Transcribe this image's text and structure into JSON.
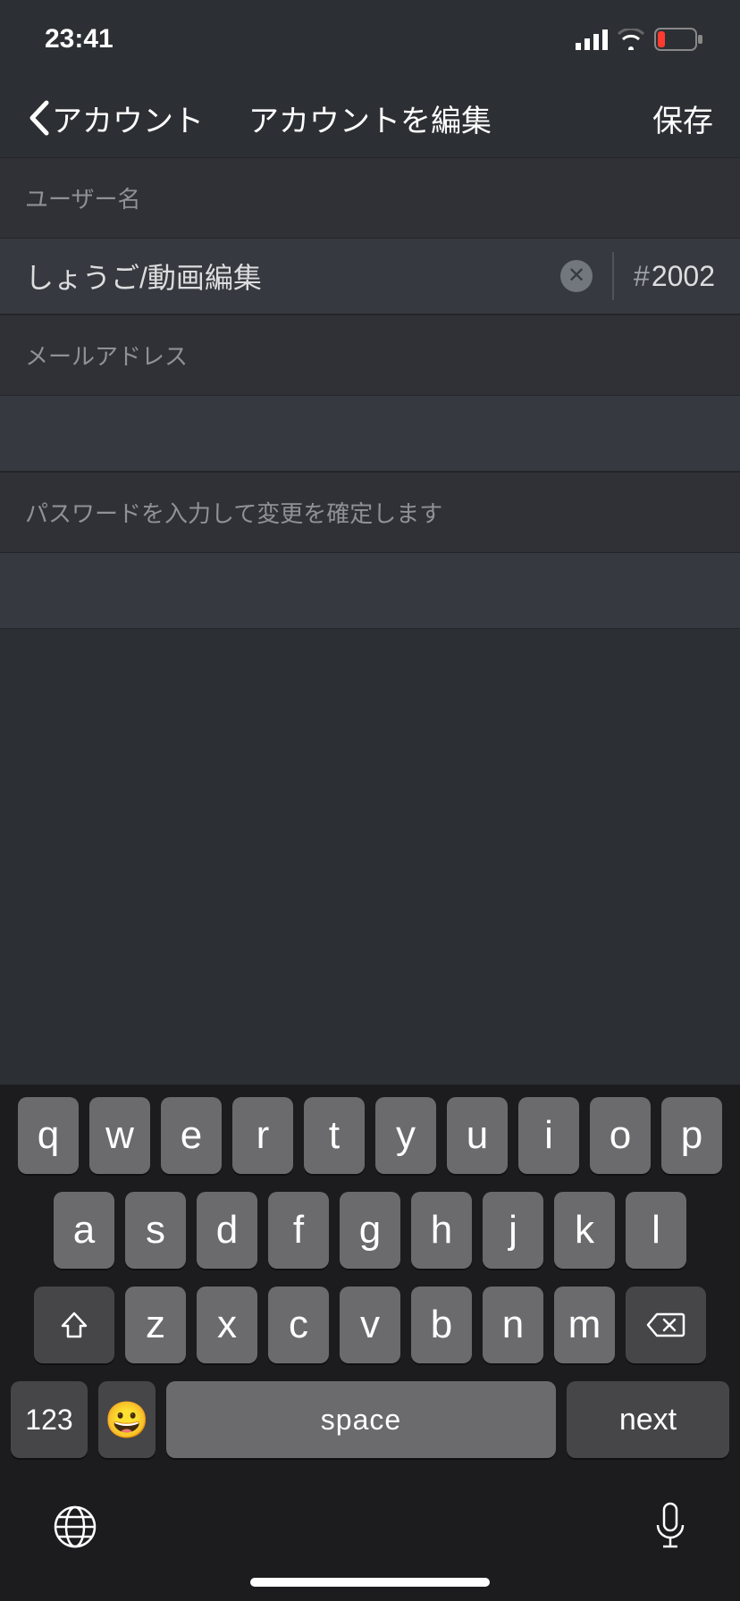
{
  "status": {
    "time": "23:41"
  },
  "nav": {
    "back": "アカウント",
    "title": "アカウントを編集",
    "save": "保存"
  },
  "form": {
    "username_label": "ユーザー名",
    "username_value": "しょうご/動画編集",
    "discrim_hash": "#",
    "discrim_value": "2002",
    "email_label": "メールアドレス",
    "email_value": "",
    "password_label": "パスワードを入力して変更を確定します",
    "password_value": ""
  },
  "keyboard": {
    "row1": [
      "q",
      "w",
      "e",
      "r",
      "t",
      "y",
      "u",
      "i",
      "o",
      "p"
    ],
    "row2": [
      "a",
      "s",
      "d",
      "f",
      "g",
      "h",
      "j",
      "k",
      "l"
    ],
    "row3": [
      "z",
      "x",
      "c",
      "v",
      "b",
      "n",
      "m"
    ],
    "k123": "123",
    "emoji": "😀",
    "space": "space",
    "next": "next"
  }
}
